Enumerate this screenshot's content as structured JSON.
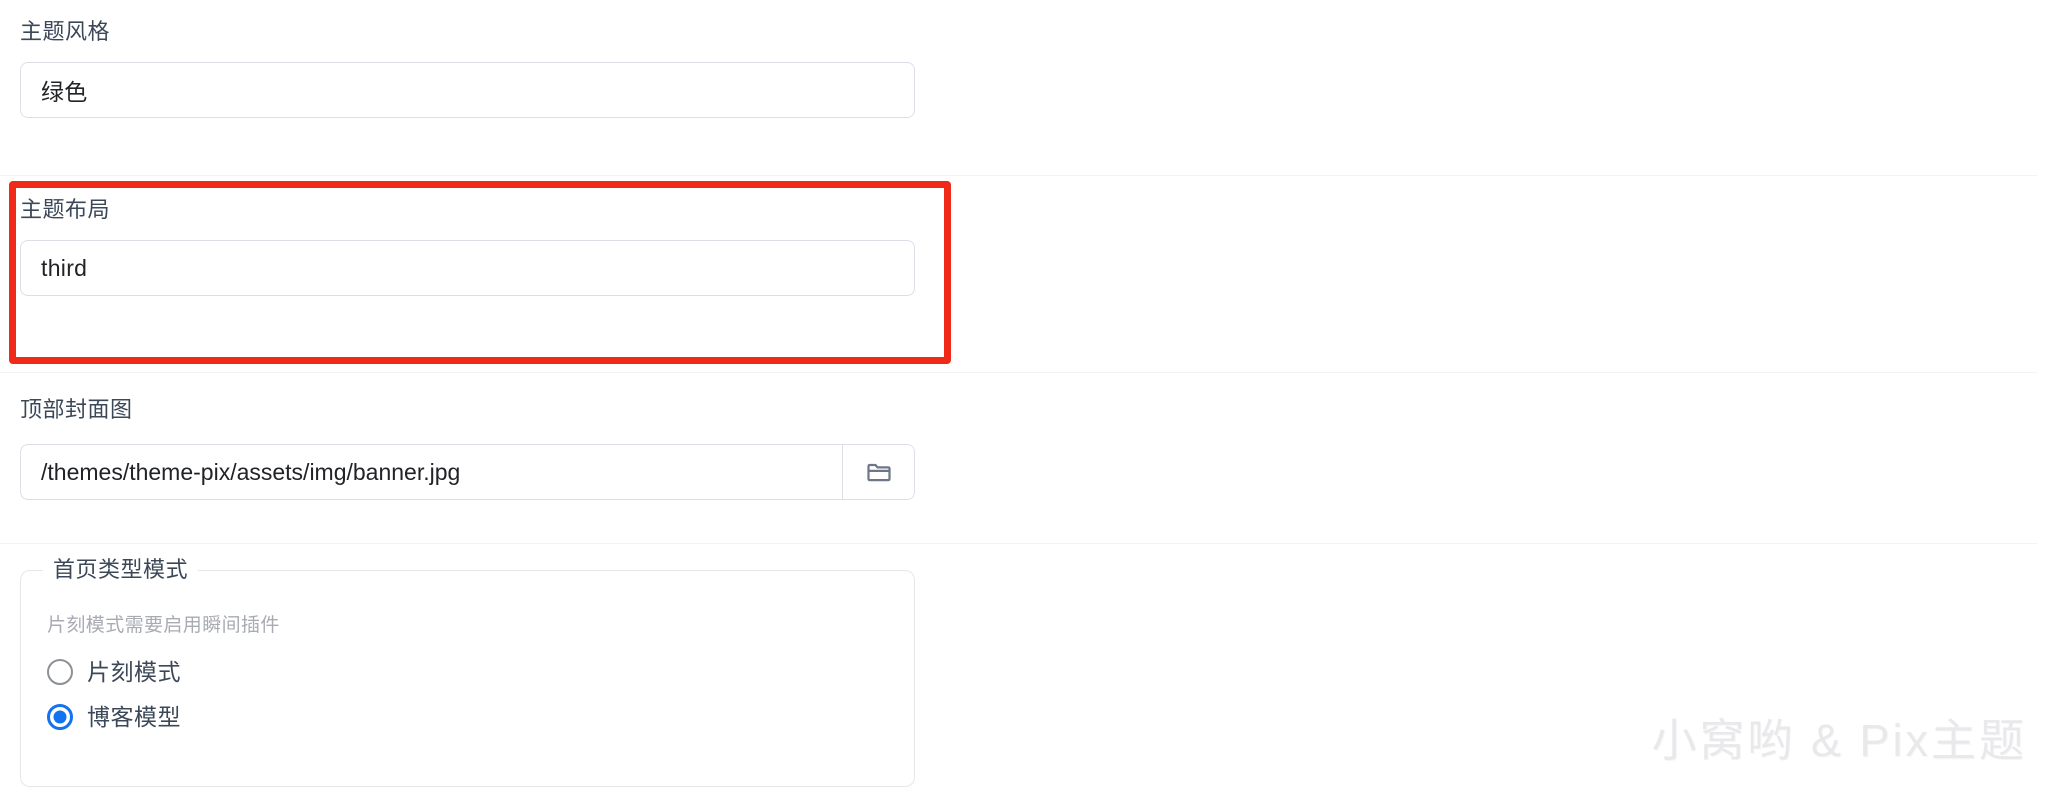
{
  "fields": {
    "theme_style": {
      "label": "主题风格",
      "value": "绿色"
    },
    "theme_layout": {
      "label": "主题布局",
      "value": "third",
      "highlighted": true,
      "highlight_color": "#ef2a18"
    },
    "top_cover_image": {
      "label": "顶部封面图",
      "value": "/themes/theme-pix/assets/img/banner.jpg",
      "browse_icon": "folder-icon"
    }
  },
  "home_type_fieldset": {
    "legend": "首页类型模式",
    "hint": "片刻模式需要启用瞬间插件",
    "options": [
      {
        "label": "片刻模式",
        "checked": false
      },
      {
        "label": "博客模型",
        "checked": true
      }
    ],
    "accent_color": "#1372ee"
  },
  "watermark": {
    "text": "小窝哟 & Pix主题"
  }
}
